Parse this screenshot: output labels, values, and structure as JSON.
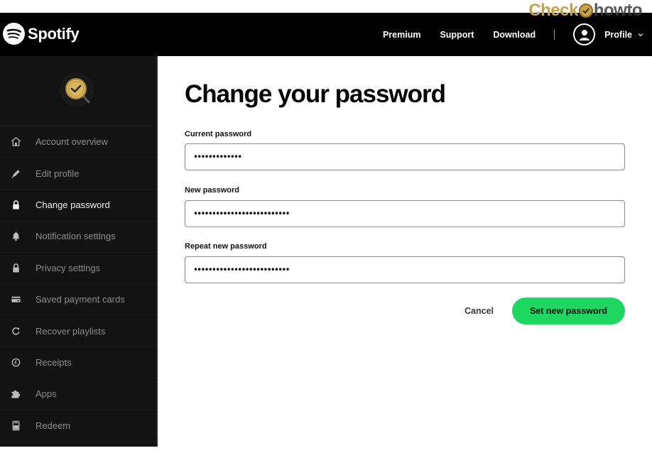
{
  "watermark": {
    "part1": "Check",
    "part2": "howto"
  },
  "navbar": {
    "brand": "Spotify",
    "links": [
      {
        "label": "Premium"
      },
      {
        "label": "Support"
      },
      {
        "label": "Download"
      }
    ],
    "profile_label": "Profile"
  },
  "sidebar": {
    "logo_icon": "gold-check-magnifier-icon",
    "items": [
      {
        "label": "Account overview",
        "icon": "home-icon",
        "active": false
      },
      {
        "label": "Edit profile",
        "icon": "pencil-icon",
        "active": false
      },
      {
        "label": "Change password",
        "icon": "lock-icon",
        "active": true
      },
      {
        "label": "Notification settings",
        "icon": "bell-icon",
        "active": false
      },
      {
        "label": "Privacy settings",
        "icon": "lock-icon",
        "active": false
      },
      {
        "label": "Saved payment cards",
        "icon": "card-icon",
        "active": false
      },
      {
        "label": "Recover playlists",
        "icon": "refresh-icon",
        "active": false
      },
      {
        "label": "Receipts",
        "icon": "clock-icon",
        "active": false
      },
      {
        "label": "Apps",
        "icon": "puzzle-icon",
        "active": false
      },
      {
        "label": "Redeem",
        "icon": "redeem-card-icon",
        "active": false
      }
    ]
  },
  "main": {
    "title": "Change your password",
    "fields": [
      {
        "label": "Current password",
        "value": "•••••••••••••"
      },
      {
        "label": "New password",
        "value": "••••••••••••••••••••••••••"
      },
      {
        "label": "Repeat new password",
        "value": "••••••••••••••••••••••••••"
      }
    ],
    "cancel_label": "Cancel",
    "submit_label": "Set new password"
  },
  "colors": {
    "accent_green": "#1ed760",
    "navbar_bg": "#000000",
    "sidebar_bg": "#121212",
    "sidebar_text": "#8a8a8a",
    "sidebar_active_text": "#f0f0f0",
    "watermark_gold": "#c9a349"
  }
}
